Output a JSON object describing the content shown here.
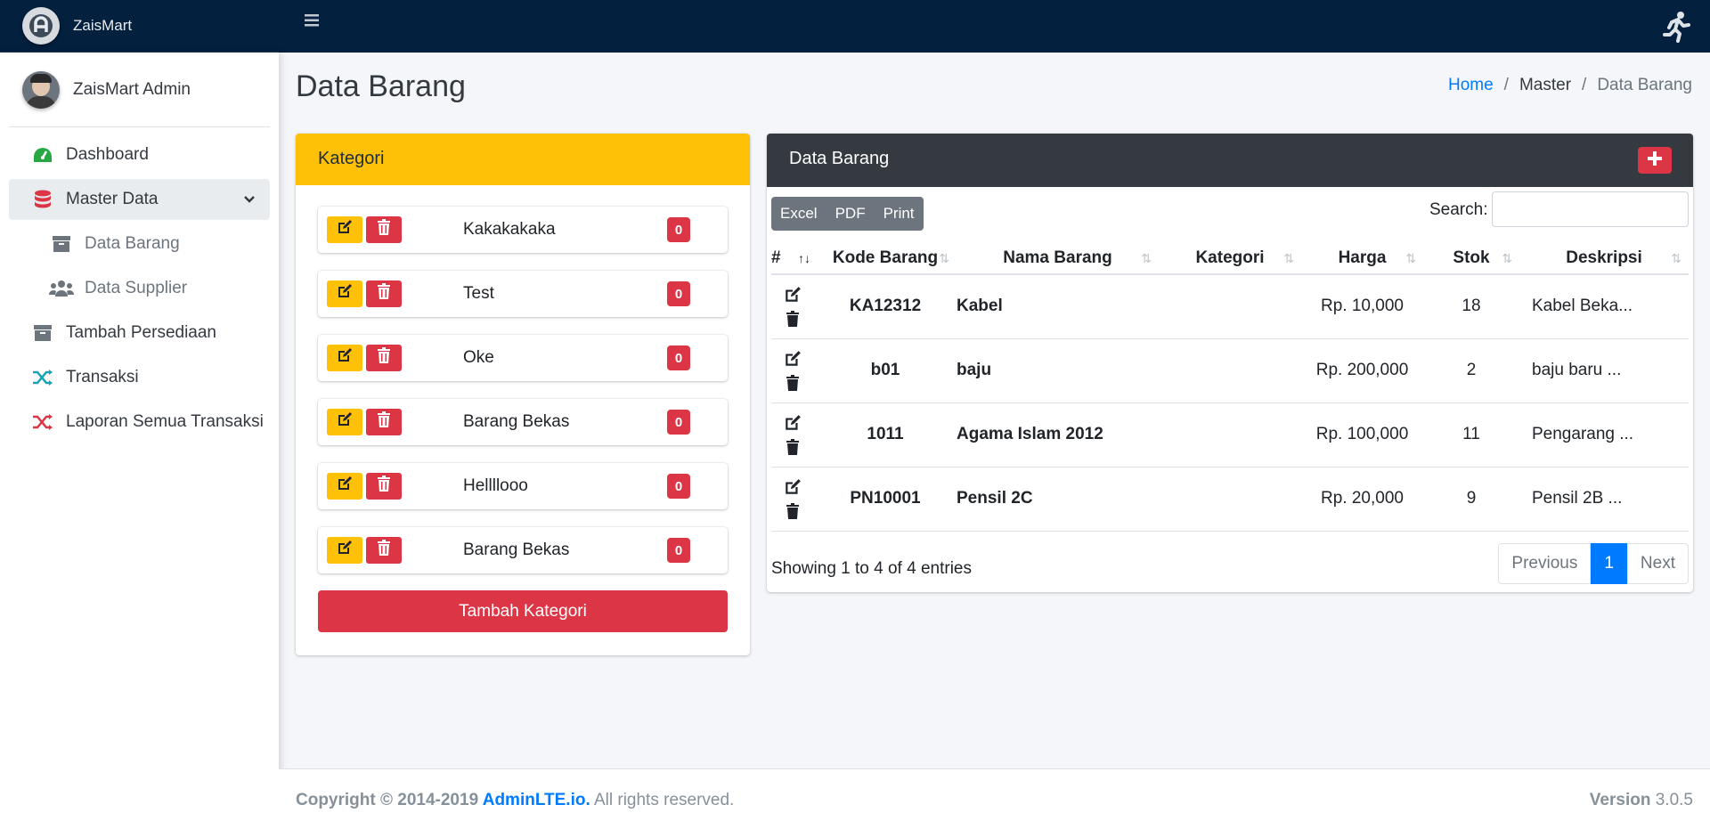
{
  "brand": {
    "name": "ZaisMart"
  },
  "user": {
    "name": "ZaisMart Admin"
  },
  "sidebar": {
    "items": [
      {
        "label": "Dashboard"
      },
      {
        "label": "Master Data"
      },
      {
        "label": "Data Barang"
      },
      {
        "label": "Data Supplier"
      },
      {
        "label": "Tambah Persediaan"
      },
      {
        "label": "Transaksi"
      },
      {
        "label": "Laporan Semua Transaksi"
      }
    ]
  },
  "page": {
    "title": "Data Barang"
  },
  "breadcrumb": {
    "home": "Home",
    "master": "Master",
    "current": "Data Barang"
  },
  "kategori": {
    "title": "Kategori",
    "items": [
      {
        "name": "Kakakakaka",
        "count": "0"
      },
      {
        "name": "Test",
        "count": "0"
      },
      {
        "name": "Oke",
        "count": "0"
      },
      {
        "name": "Barang Bekas",
        "count": "0"
      },
      {
        "name": "Hellllooo",
        "count": "0"
      },
      {
        "name": "Barang Bekas",
        "count": "0"
      }
    ],
    "add_label": "Tambah Kategori"
  },
  "barang": {
    "title": "Data Barang",
    "export": {
      "excel": "Excel",
      "pdf": "PDF",
      "print": "Print"
    },
    "search_label": "Search:",
    "columns": [
      "#",
      "Kode Barang",
      "Nama Barang",
      "Kategori",
      "Harga",
      "Stok",
      "Deskripsi"
    ],
    "rows": [
      {
        "kode": "KA12312",
        "nama": "Kabel",
        "kategori": "",
        "harga": "Rp. 10,000",
        "stok": "18",
        "deskripsi": "Kabel Beka..."
      },
      {
        "kode": "b01",
        "nama": "baju",
        "kategori": "",
        "harga": "Rp. 200,000",
        "stok": "2",
        "deskripsi": "baju baru ..."
      },
      {
        "kode": "1011",
        "nama": "Agama Islam 2012",
        "kategori": "",
        "harga": "Rp. 100,000",
        "stok": "11",
        "deskripsi": "Pengarang ..."
      },
      {
        "kode": "PN10001",
        "nama": "Pensil 2C",
        "kategori": "",
        "harga": "Rp. 20,000",
        "stok": "9",
        "deskripsi": "Pensil 2B ..."
      }
    ],
    "info": "Showing 1 to 4 of 4 entries",
    "pager": {
      "previous": "Previous",
      "current": "1",
      "next": "Next"
    }
  },
  "footer": {
    "copyright": "Copyright © 2014-2019 ",
    "link": "AdminLTE.io.",
    "rights": " All rights reserved.",
    "version_label": "Version",
    "version": " 3.0.5"
  },
  "colors": {
    "navbar": "#04203f",
    "warning": "#ffc107",
    "danger": "#dc3545",
    "primary": "#007bff",
    "dark": "#343a40"
  }
}
